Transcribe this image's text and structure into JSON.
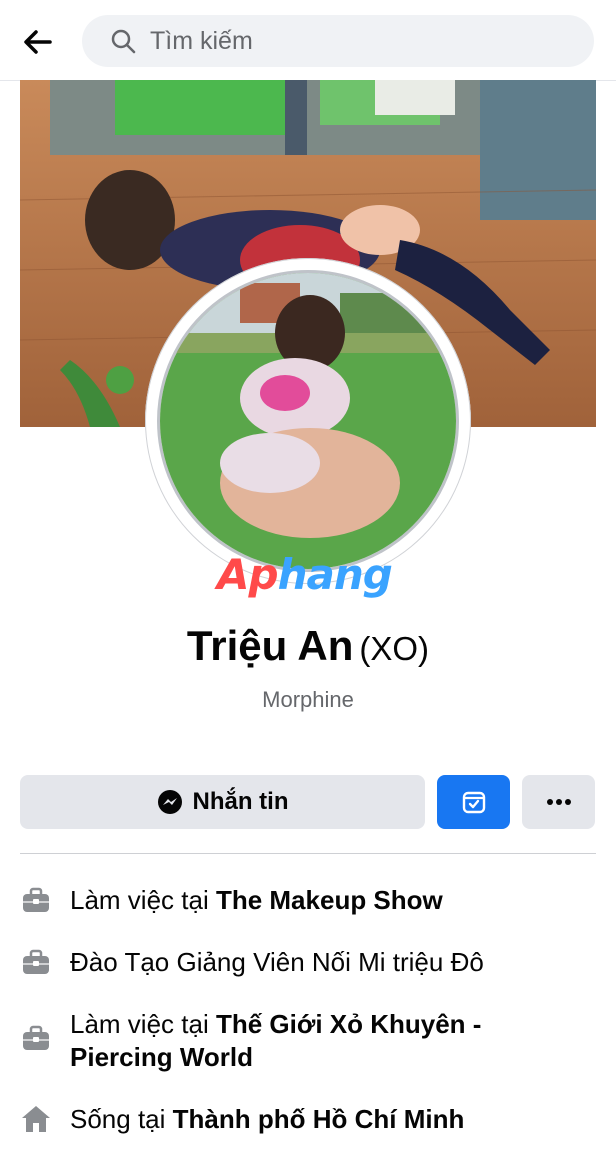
{
  "search": {
    "placeholder": "Tìm kiếm"
  },
  "profile": {
    "name": "Triệu An",
    "alt_name": "(XO)",
    "subtitle": "Morphine"
  },
  "watermark": {
    "part1": "Ap",
    "part2": "hang"
  },
  "actions": {
    "message_label": "Nhắn tin"
  },
  "info": [
    {
      "icon": "briefcase-icon",
      "prefix": "Làm việc tại ",
      "value": "The Makeup Show"
    },
    {
      "icon": "briefcase-icon",
      "prefix": "",
      "value": "Đào Tạo Giảng Viên Nối Mi triệu Đô"
    },
    {
      "icon": "briefcase-icon",
      "prefix": "Làm việc tại ",
      "value": "Thế Giới Xỏ Khuyên -",
      "value2": "Piercing World"
    },
    {
      "icon": "home-icon",
      "prefix": "Sống tại ",
      "value": "Thành phố Hồ Chí Minh"
    }
  ],
  "colors": {
    "accent": "#1877f2",
    "button_gray": "#e4e6eb",
    "secondary_text": "#65676b"
  }
}
